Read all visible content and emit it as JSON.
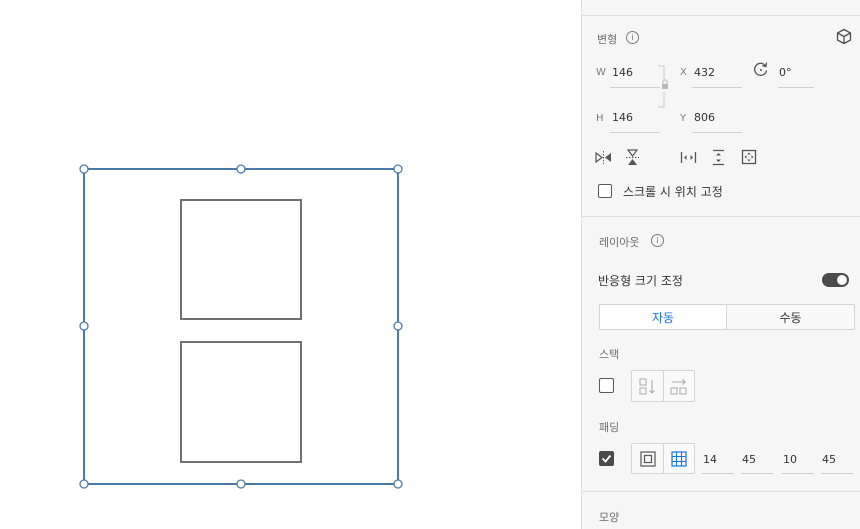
{
  "transform": {
    "title": "변형",
    "w_label": "W",
    "w_value": "146",
    "h_label": "H",
    "h_value": "146",
    "x_label": "X",
    "x_value": "432",
    "y_label": "Y",
    "y_value": "806",
    "rotation_value": "0°",
    "fix_on_scroll_label": "스크롤 시 위치 고정"
  },
  "layout": {
    "title": "레이아웃",
    "responsive_resize_label": "반응형 크기 조정",
    "auto_label": "자동",
    "manual_label": "수동",
    "stack_label": "스택",
    "padding_label": "패딩",
    "padding_values": [
      "14",
      "45",
      "10",
      "45"
    ]
  },
  "appearance": {
    "title": "모양"
  },
  "colors": {
    "accent": "#1473e6",
    "selection": "#4a7aa7"
  }
}
